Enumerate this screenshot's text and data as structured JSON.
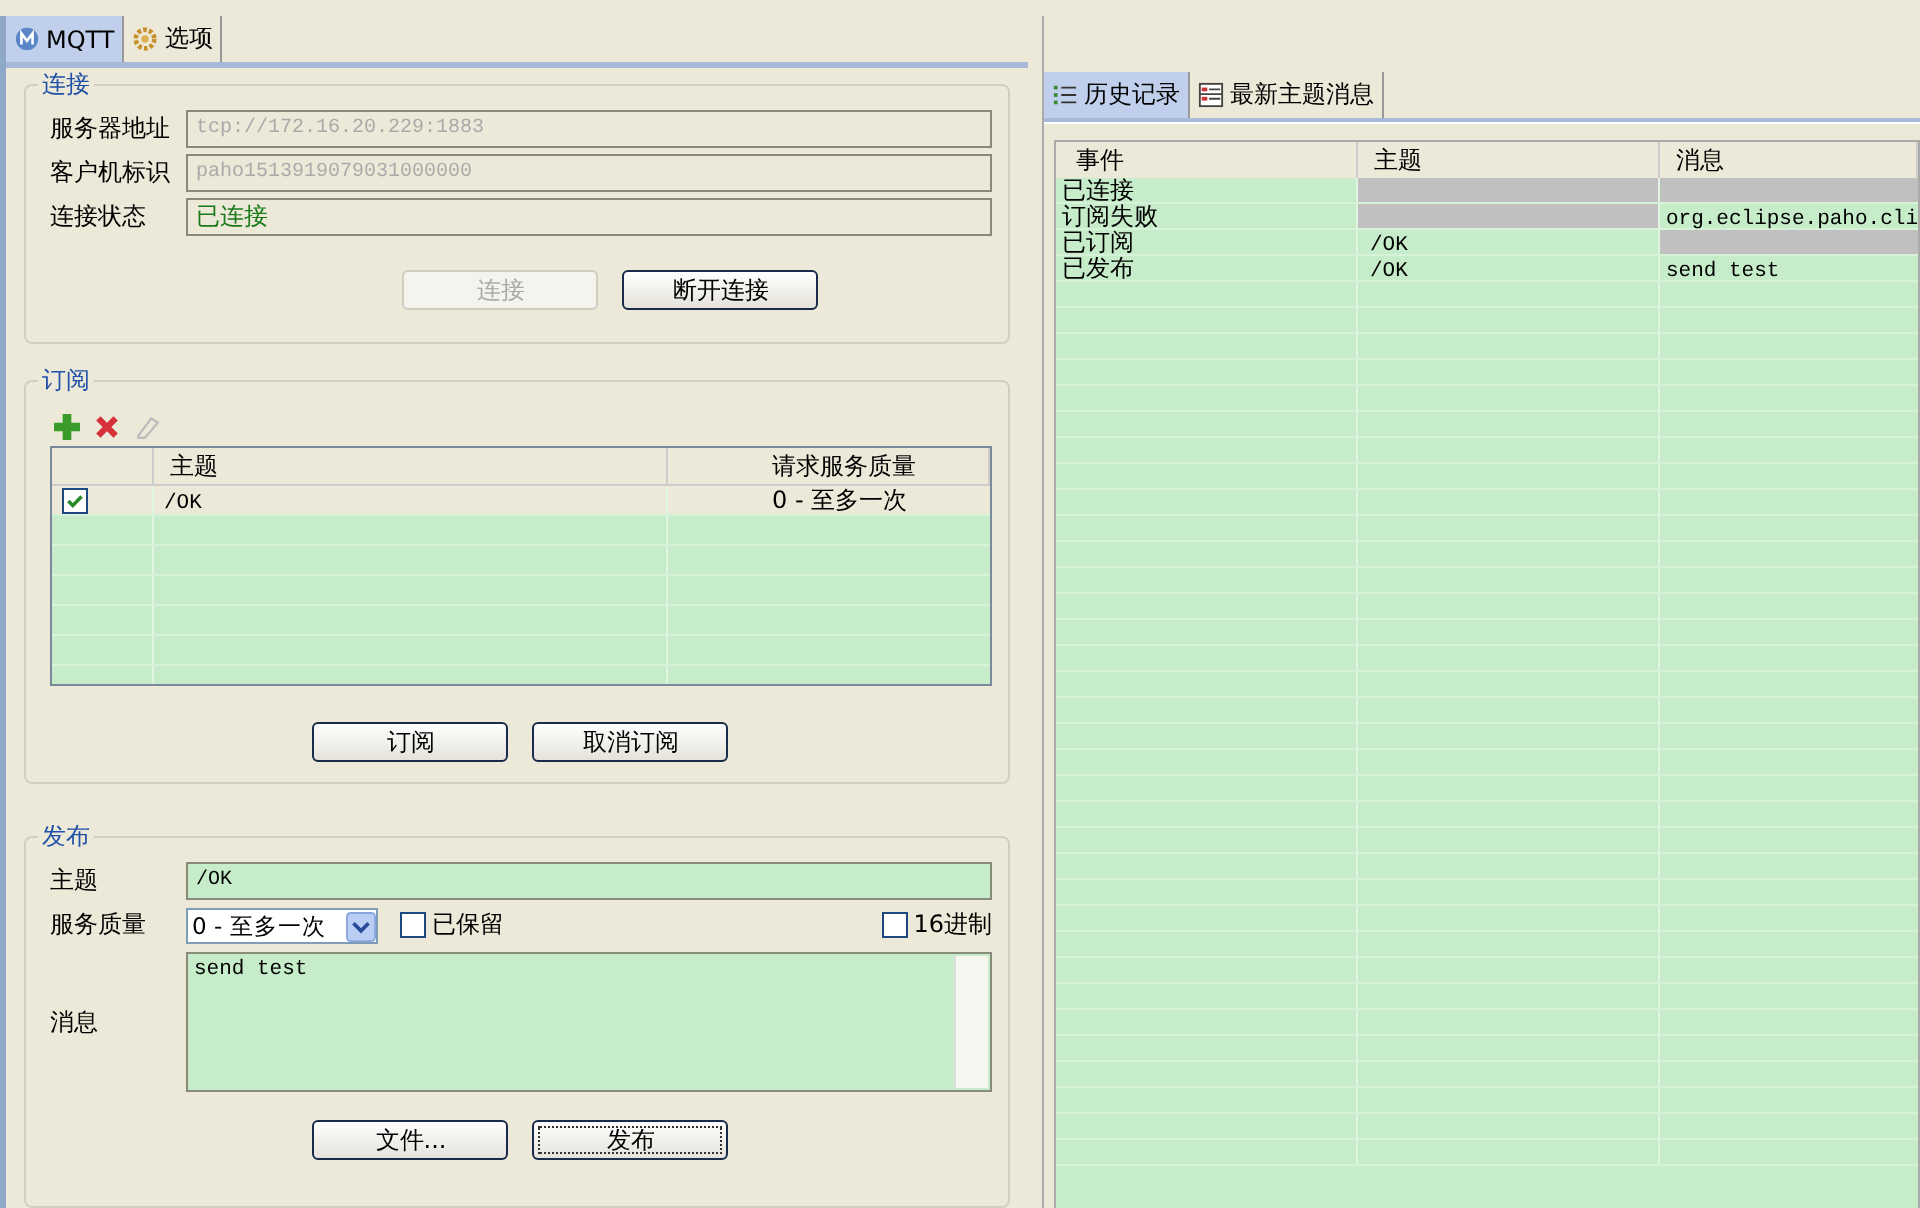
{
  "tabs": [
    {
      "label": "MQTT",
      "selected": true
    },
    {
      "label": "选项",
      "selected": false
    }
  ],
  "connection": {
    "title": "连接",
    "fields": [
      {
        "label": "服务器地址",
        "value": "tcp://172.16.20.229:1883",
        "disabled": true
      },
      {
        "label": "客户机标识",
        "value": "paho1513919079031000000",
        "disabled": true
      },
      {
        "label": "连接状态",
        "value": "已连接",
        "disabled": false
      }
    ],
    "buttons": [
      {
        "label": "连接",
        "disabled": true
      },
      {
        "label": "断开连接",
        "disabled": false
      }
    ]
  },
  "subscription": {
    "title": "订阅",
    "columns": [
      "主题",
      "请求服务质量"
    ],
    "rows": [
      {
        "checked": true,
        "topic": "/OK",
        "qos": "0 - 至多一次"
      }
    ],
    "buttons": [
      {
        "label": "订阅",
        "disabled": false
      },
      {
        "label": "取消订阅",
        "disabled": false
      }
    ]
  },
  "publish": {
    "title": "发布",
    "topic_label": "主题",
    "topic": "/OK",
    "qos_label": "服务质量",
    "qos": "0 - 至多一次",
    "retained_label": "已保留",
    "retained": false,
    "hex_label": "16进制",
    "hex": false,
    "message_label": "消息",
    "message": "send test",
    "buttons": [
      {
        "label": "文件...",
        "focused": false
      },
      {
        "label": "发布",
        "focused": true
      }
    ]
  },
  "history_tabs": [
    {
      "label": "历史记录",
      "selected": true
    },
    {
      "label": "最新主题消息",
      "selected": false
    }
  ],
  "history": {
    "columns": [
      "事件",
      "主题",
      "消息"
    ],
    "rows": [
      {
        "event": "已连接"
      },
      {
        "event": "订阅失败",
        "message": "org.eclipse.paho.cli"
      },
      {
        "event": "已订阅",
        "topic": "/OK"
      },
      {
        "event": "已发布",
        "topic": "/OK",
        "message": "send test"
      }
    ]
  }
}
